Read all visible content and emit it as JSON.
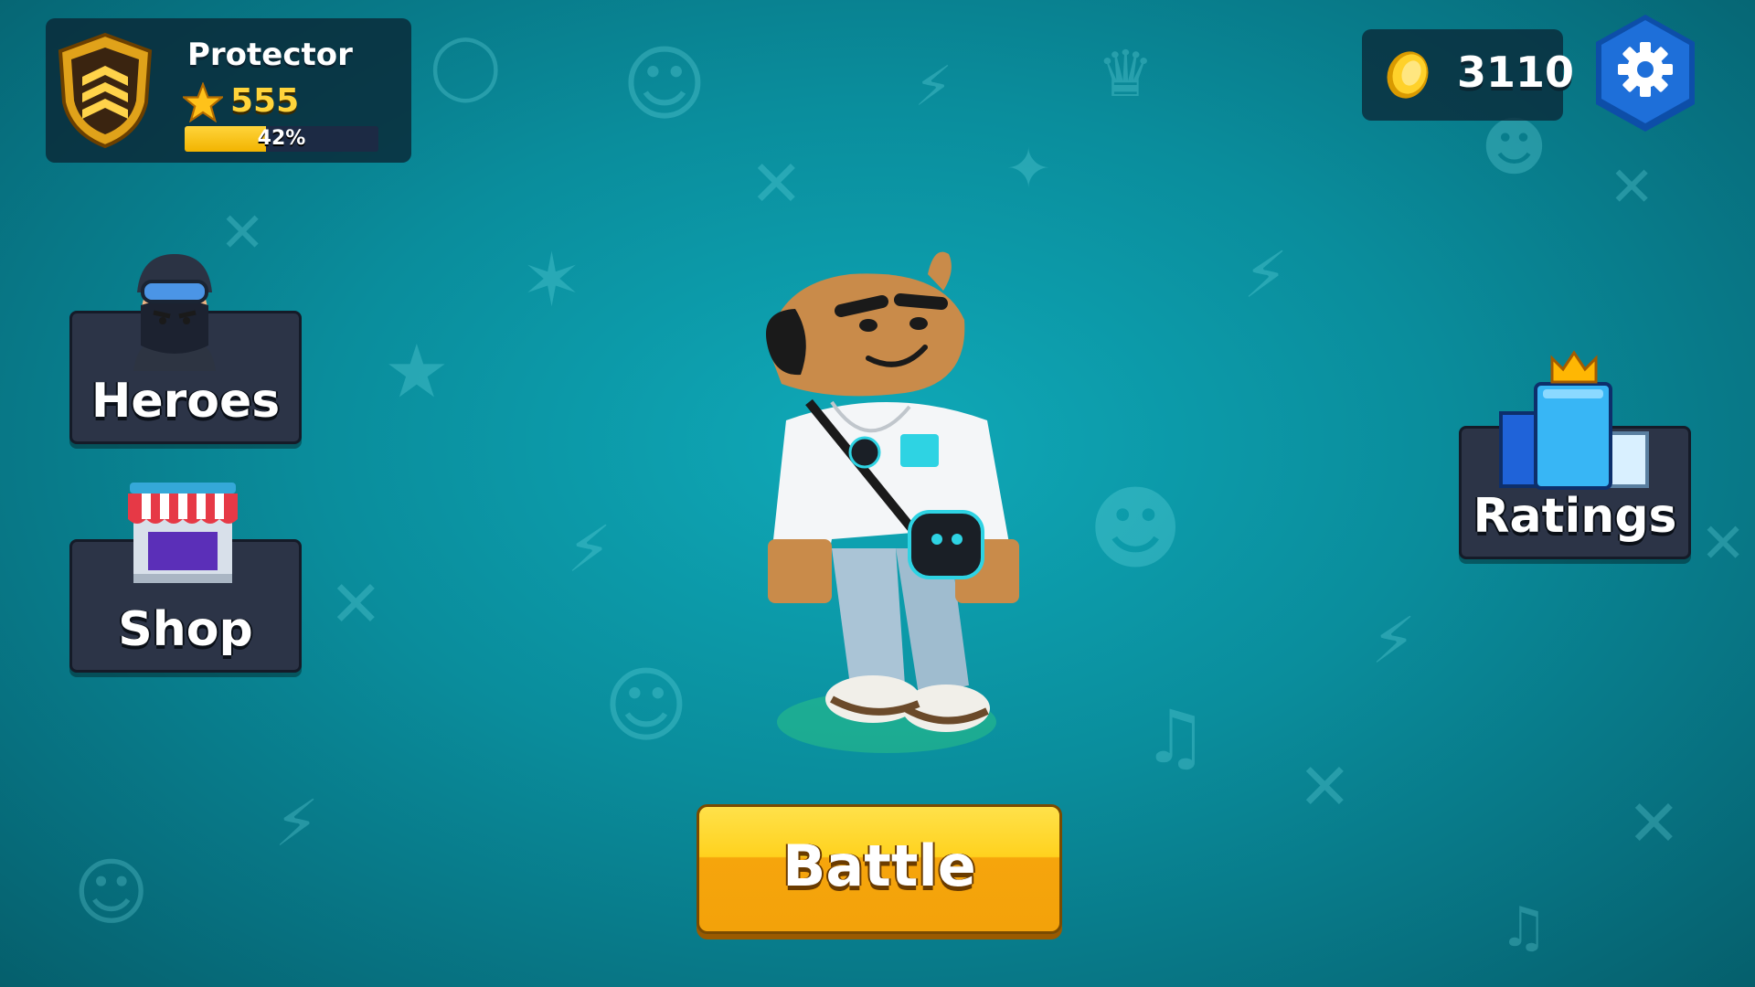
{
  "profile": {
    "name": "Protector",
    "trophies": "555",
    "progress_label": "42%",
    "progress_fraction": 0.42,
    "rank_icon": "chevron-shield-icon"
  },
  "currency": {
    "coins": "3110",
    "coin_icon": "gold-coin-icon"
  },
  "settings": {
    "icon": "gear-icon"
  },
  "menu": {
    "heroes_label": "Heroes",
    "shop_label": "Shop",
    "ratings_label": "Ratings"
  },
  "battle": {
    "label": "Battle"
  },
  "colors": {
    "accent_yellow": "#ffd21e",
    "panel_dark": "#2c3447",
    "background_teal": "#0a8d9c",
    "settings_blue": "#1e6fd9"
  }
}
